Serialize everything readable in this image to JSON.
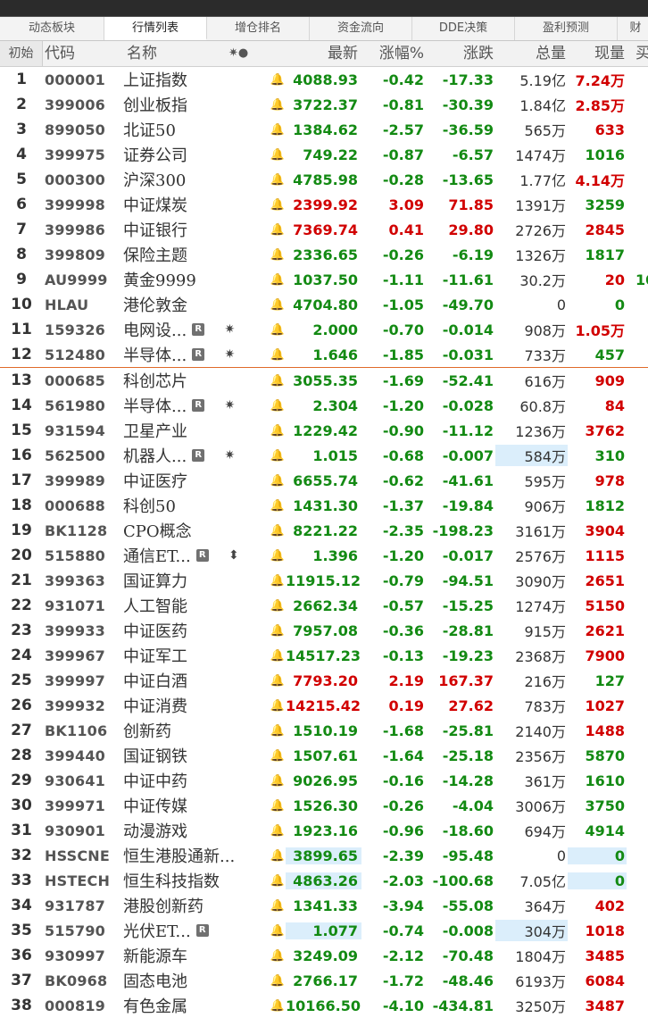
{
  "tabs": [
    "动态板块",
    "行情列表",
    "增仓排名",
    "资金流向",
    "DDE决策",
    "盈利预测",
    "财"
  ],
  "active_tab": 1,
  "header": {
    "init": "初始",
    "code": "代码",
    "name": "名称",
    "mark": "✷●",
    "last": "最新",
    "pct": "涨幅%",
    "chg": "涨跌",
    "vol": "总量",
    "cur": "现量",
    "extra": "买"
  },
  "rows": [
    {
      "i": "1",
      "code": "000001",
      "name": "上证指数",
      "last": "4088.93",
      "pct": "-0.42",
      "chg": "-17.33",
      "vol": "5.19",
      "vu": "亿",
      "cur": "7.24",
      "cu": "万",
      "cd": "up"
    },
    {
      "i": "2",
      "code": "399006",
      "name": "创业板指",
      "last": "3722.37",
      "pct": "-0.81",
      "chg": "-30.39",
      "vol": "1.84",
      "vu": "亿",
      "cur": "2.85",
      "cu": "万",
      "cd": "up"
    },
    {
      "i": "3",
      "code": "899050",
      "name": "北证50",
      "last": "1384.62",
      "pct": "-2.57",
      "chg": "-36.59",
      "vol": "565",
      "vu": "万",
      "cur": "633",
      "cd": "up"
    },
    {
      "i": "4",
      "code": "399975",
      "name": "证券公司",
      "last": "749.22",
      "pct": "-0.87",
      "chg": "-6.57",
      "vol": "1474",
      "vu": "万",
      "cur": "1016",
      "cd": "dn"
    },
    {
      "i": "5",
      "code": "000300",
      "name": "沪深300",
      "last": "4785.98",
      "pct": "-0.28",
      "chg": "-13.65",
      "vol": "1.77",
      "vu": "亿",
      "cur": "4.14",
      "cu": "万",
      "cd": "up"
    },
    {
      "i": "6",
      "code": "399998",
      "name": "中证煤炭",
      "last": "2399.92",
      "pct": "3.09",
      "chg": "71.85",
      "vol": "1391",
      "vu": "万",
      "cur": "3259",
      "cd": "dn",
      "d": "up"
    },
    {
      "i": "7",
      "code": "399986",
      "name": "中证银行",
      "last": "7369.74",
      "pct": "0.41",
      "chg": "29.80",
      "vol": "2726",
      "vu": "万",
      "cur": "2845",
      "cd": "up",
      "d": "up"
    },
    {
      "i": "8",
      "code": "399809",
      "name": "保险主题",
      "last": "2336.65",
      "pct": "-0.26",
      "chg": "-6.19",
      "vol": "1326",
      "vu": "万",
      "cur": "1817",
      "cd": "dn"
    },
    {
      "i": "9",
      "code": "AU9999",
      "name": "黄金9999",
      "last": "1037.50",
      "pct": "-1.11",
      "chg": "-11.61",
      "vol": "30.2",
      "vu": "万",
      "cur": "20",
      "cd": "up",
      "extra": "10"
    },
    {
      "i": "10",
      "code": "HLAU",
      "name": "港伦敦金",
      "last": "4704.80",
      "pct": "-1.05",
      "chg": "-49.70",
      "vol": "0",
      "cur": "0",
      "cd": "dn"
    },
    {
      "i": "11",
      "code": "159326",
      "name": "电网设...",
      "r": true,
      "mark": "✷",
      "last": "2.000",
      "pct": "-0.70",
      "chg": "-0.014",
      "vol": "908",
      "vu": "万",
      "cur": "1.05",
      "cu": "万",
      "cd": "up"
    },
    {
      "i": "12",
      "code": "512480",
      "name": "半导体...",
      "r": true,
      "mark": "✷",
      "last": "1.646",
      "pct": "-1.85",
      "chg": "-0.031",
      "vol": "733",
      "vu": "万",
      "cur": "457",
      "cd": "dn",
      "sep": true
    },
    {
      "i": "13",
      "code": "000685",
      "name": "科创芯片",
      "last": "3055.35",
      "pct": "-1.69",
      "chg": "-52.41",
      "vol": "616",
      "vu": "万",
      "cur": "909",
      "cd": "up"
    },
    {
      "i": "14",
      "code": "561980",
      "name": "半导体...",
      "r": true,
      "mark": "✷",
      "last": "2.304",
      "pct": "-1.20",
      "chg": "-0.028",
      "vol": "60.8",
      "vu": "万",
      "cur": "84",
      "cd": "up"
    },
    {
      "i": "15",
      "code": "931594",
      "name": "卫星产业",
      "last": "1229.42",
      "pct": "-0.90",
      "chg": "-11.12",
      "vol": "1236",
      "vu": "万",
      "cur": "3762",
      "cd": "up"
    },
    {
      "i": "16",
      "code": "562500",
      "name": "机器人...",
      "r": true,
      "mark": "✷",
      "last": "1.015",
      "pct": "-0.68",
      "chg": "-0.007",
      "vol": "584",
      "vu": "万",
      "cur": "310",
      "cd": "dn",
      "hv": true
    },
    {
      "i": "17",
      "code": "399989",
      "name": "中证医疗",
      "last": "6655.74",
      "pct": "-0.62",
      "chg": "-41.61",
      "vol": "595",
      "vu": "万",
      "cur": "978",
      "cd": "up"
    },
    {
      "i": "18",
      "code": "000688",
      "name": "科创50",
      "last": "1431.30",
      "pct": "-1.37",
      "chg": "-19.84",
      "vol": "906",
      "vu": "万",
      "cur": "1812",
      "cd": "dn"
    },
    {
      "i": "19",
      "code": "BK1128",
      "name": "CPO概念",
      "last": "8221.22",
      "pct": "-2.35",
      "chg": "-198.23",
      "vol": "3161",
      "vu": "万",
      "cur": "3904",
      "cd": "up"
    },
    {
      "i": "20",
      "code": "515880",
      "name": "通信ET...",
      "r": true,
      "mark": "⬍",
      "last": "1.396",
      "pct": "-1.20",
      "chg": "-0.017",
      "vol": "2576",
      "vu": "万",
      "cur": "1115",
      "cd": "up"
    },
    {
      "i": "21",
      "code": "399363",
      "name": "国证算力",
      "last": "11915.12",
      "pct": "-0.79",
      "chg": "-94.51",
      "vol": "3090",
      "vu": "万",
      "cur": "2651",
      "cd": "up"
    },
    {
      "i": "22",
      "code": "931071",
      "name": "人工智能",
      "last": "2662.34",
      "pct": "-0.57",
      "chg": "-15.25",
      "vol": "1274",
      "vu": "万",
      "cur": "5150",
      "cd": "up"
    },
    {
      "i": "23",
      "code": "399933",
      "name": "中证医药",
      "last": "7957.08",
      "pct": "-0.36",
      "chg": "-28.81",
      "vol": "915",
      "vu": "万",
      "cur": "2621",
      "cd": "up"
    },
    {
      "i": "24",
      "code": "399967",
      "name": "中证军工",
      "last": "14517.23",
      "pct": "-0.13",
      "chg": "-19.23",
      "vol": "2368",
      "vu": "万",
      "cur": "7900",
      "cd": "up"
    },
    {
      "i": "25",
      "code": "399997",
      "name": "中证白酒",
      "last": "7793.20",
      "pct": "2.19",
      "chg": "167.37",
      "vol": "216",
      "vu": "万",
      "cur": "127",
      "cd": "dn",
      "d": "up",
      "hot": true
    },
    {
      "i": "26",
      "code": "399932",
      "name": "中证消费",
      "last": "14215.42",
      "pct": "0.19",
      "chg": "27.62",
      "vol": "783",
      "vu": "万",
      "cur": "1027",
      "cd": "up",
      "d": "up"
    },
    {
      "i": "27",
      "code": "BK1106",
      "name": "创新药",
      "last": "1510.19",
      "pct": "-1.68",
      "chg": "-25.81",
      "vol": "2140",
      "vu": "万",
      "cur": "1488",
      "cd": "up"
    },
    {
      "i": "28",
      "code": "399440",
      "name": "国证钢铁",
      "last": "1507.61",
      "pct": "-1.64",
      "chg": "-25.18",
      "vol": "2356",
      "vu": "万",
      "cur": "5870",
      "cd": "dn"
    },
    {
      "i": "29",
      "code": "930641",
      "name": "中证中药",
      "last": "9026.95",
      "pct": "-0.16",
      "chg": "-14.28",
      "vol": "361",
      "vu": "万",
      "cur": "1610",
      "cd": "dn"
    },
    {
      "i": "30",
      "code": "399971",
      "name": "中证传媒",
      "last": "1526.30",
      "pct": "-0.26",
      "chg": "-4.04",
      "vol": "3006",
      "vu": "万",
      "cur": "3750",
      "cd": "dn"
    },
    {
      "i": "31",
      "code": "930901",
      "name": "动漫游戏",
      "last": "1923.16",
      "pct": "-0.96",
      "chg": "-18.60",
      "vol": "694",
      "vu": "万",
      "cur": "4914",
      "cd": "dn"
    },
    {
      "i": "32",
      "code": "HSSCNE",
      "name": "恒生港股通新...",
      "last": "3899.65",
      "pct": "-2.39",
      "chg": "-95.48",
      "vol": "0",
      "cur": "0",
      "cd": "dn",
      "hl": true,
      "hc": true
    },
    {
      "i": "33",
      "code": "HSTECH",
      "name": "恒生科技指数",
      "last": "4863.26",
      "pct": "-2.03",
      "chg": "-100.68",
      "vol": "7.05",
      "vu": "亿",
      "cur": "0",
      "cd": "dn",
      "hl": true,
      "hc": true
    },
    {
      "i": "34",
      "code": "931787",
      "name": "港股创新药",
      "last": "1341.33",
      "pct": "-3.94",
      "chg": "-55.08",
      "vol": "364",
      "vu": "万",
      "cur": "402",
      "cd": "up"
    },
    {
      "i": "35",
      "code": "515790",
      "name": "光伏ET...",
      "r": true,
      "last": "1.077",
      "pct": "-0.74",
      "chg": "-0.008",
      "vol": "304",
      "vu": "万",
      "cur": "1018",
      "cd": "up",
      "hl": true,
      "hv": true
    },
    {
      "i": "36",
      "code": "930997",
      "name": "新能源车",
      "last": "3249.09",
      "pct": "-2.12",
      "chg": "-70.48",
      "vol": "1804",
      "vu": "万",
      "cur": "3485",
      "cd": "up"
    },
    {
      "i": "37",
      "code": "BK0968",
      "name": "固态电池",
      "last": "2766.17",
      "pct": "-1.72",
      "chg": "-48.46",
      "vol": "6193",
      "vu": "万",
      "cur": "6084",
      "cd": "up"
    },
    {
      "i": "38",
      "code": "000819",
      "name": "有色金属",
      "last": "10166.50",
      "pct": "-4.10",
      "chg": "-434.81",
      "vol": "3250",
      "vu": "万",
      "cur": "3487",
      "cd": "up"
    }
  ],
  "colors": {
    "up": "#d10000",
    "down": "#138a13",
    "highlight": "#dbeefb",
    "separator": "#e06a2a"
  }
}
